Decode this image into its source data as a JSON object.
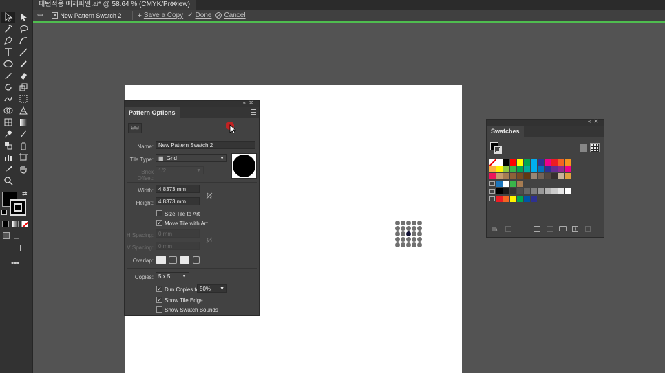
{
  "window": {
    "doc_tab_title": "패턴적용 예제파일.ai* @ 58.64 % (CMYK/Preview)",
    "close_glyph": "✕"
  },
  "isolation_bar": {
    "pattern_name": "New Pattern Swatch 2",
    "save_copy": "Save a Copy",
    "done": "Done",
    "cancel": "Cancel"
  },
  "pattern_options": {
    "title": "Pattern Options",
    "name_label": "Name:",
    "name_value": "New Pattern Swatch 2",
    "tile_type_label": "Tile Type:",
    "tile_type_value": "Grid",
    "brick_offset_label": "Brick Offset:",
    "brick_offset_value": "1/2",
    "width_label": "Width:",
    "width_value": "4.8373 mm",
    "height_label": "Height:",
    "height_value": "4.8373 mm",
    "size_tile_to_art": "Size Tile to Art",
    "move_tile_with_art": "Move Tile with Art",
    "h_spacing_label": "H Spacing:",
    "h_spacing_value": "0 mm",
    "v_spacing_label": "V Spacing:",
    "v_spacing_value": "0 mm",
    "overlap_label": "Overlap:",
    "copies_label": "Copies:",
    "copies_value": "5 x 5",
    "dim_copies_label": "Dim Copies to:",
    "dim_copies_value": "50%",
    "show_tile_edge": "Show Tile Edge",
    "show_swatch_bounds": "Show Swatch Bounds",
    "size_tile_checked": false,
    "move_tile_checked": true,
    "dim_copies_checked": true,
    "show_tile_edge_checked": true,
    "show_swatch_bounds_checked": false
  },
  "swatches": {
    "title": "Swatches",
    "rows": [
      [
        "none",
        "#ffffff",
        "#000000",
        "#ff0000",
        "#ffff00",
        "#00a651",
        "#00aeef",
        "#2e3192",
        "#ec008c",
        "#ed1c24",
        "#f26522",
        "#f7941d"
      ],
      [
        "#fbb040",
        "#fff200",
        "#8dc63f",
        "#39b54a",
        "#00a651",
        "#00a99d",
        "#00aeef",
        "#0072bc",
        "#2e3192",
        "#662d91",
        "#92278f",
        "#ec008c"
      ],
      [
        "#ed145b",
        "#c69c6d",
        "#a67c52",
        "#8c6239",
        "#754c24",
        "#603913",
        "#998675",
        "#736357",
        "#534741",
        "#362f2d",
        "#c7b299",
        "#e0a040"
      ],
      [
        "#1c75bc",
        "#ffffff",
        "#39b54a",
        "#a67c52"
      ],
      [
        "#000000",
        "#1a1a1a",
        "#333333",
        "#4d4d4d",
        "#666666",
        "#808080",
        "#999999",
        "#b3b3b3",
        "#cccccc",
        "#e6e6e6",
        "#ffffff"
      ],
      [
        "#ed1c24",
        "#f26522",
        "#fff200",
        "#00a651",
        "#0054a6",
        "#2e3192"
      ]
    ]
  }
}
